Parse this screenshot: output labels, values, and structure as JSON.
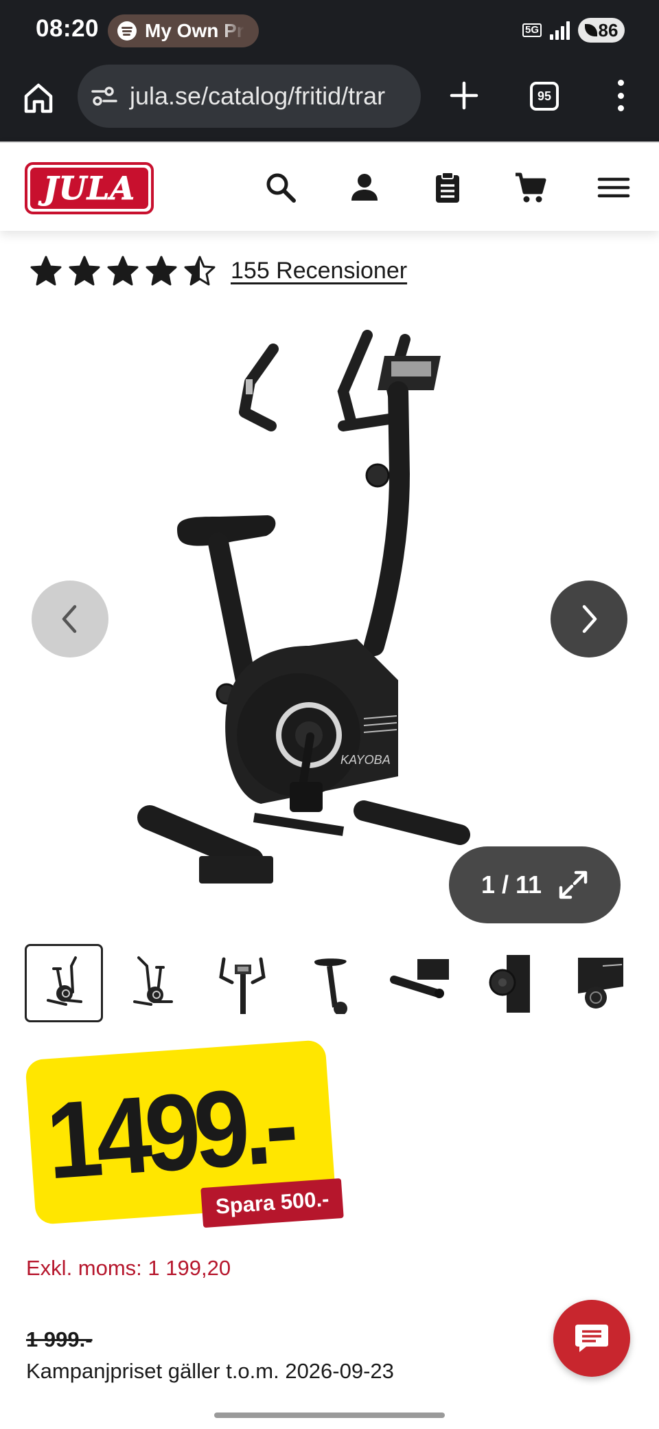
{
  "status_bar": {
    "time": "08:20",
    "media_title": "My Own Pr",
    "network": "5G",
    "battery": "86"
  },
  "browser": {
    "url": "jula.se/catalog/fritid/trar",
    "tab_count": "95",
    "icons": [
      "home-icon",
      "site-settings-icon",
      "plus-icon",
      "tabs-icon",
      "more-icon"
    ]
  },
  "header": {
    "logo": "JULA",
    "icons": [
      "search-icon",
      "account-icon",
      "shopping-list-icon",
      "cart-icon",
      "menu-icon"
    ]
  },
  "rating": {
    "stars": 4.5,
    "max_stars": 5,
    "reviews_label": "155 Recensioner"
  },
  "gallery": {
    "counter": "1 / 11",
    "current": 1,
    "total": 11,
    "product_brand": "KAYOBA"
  },
  "price": {
    "value": "1499.-",
    "savings": "Spara 500.-",
    "ex_vat": "Exkl. moms: 1 199,20",
    "original": "1 999.-",
    "campaign_note": "Kampanjpriset gäller t.o.m. 2026-09-23"
  },
  "colors": {
    "brand_red": "#c8102e",
    "price_yellow": "#ffe600",
    "savings_red": "#b6162c",
    "chrome_dark": "#1c1e22"
  }
}
